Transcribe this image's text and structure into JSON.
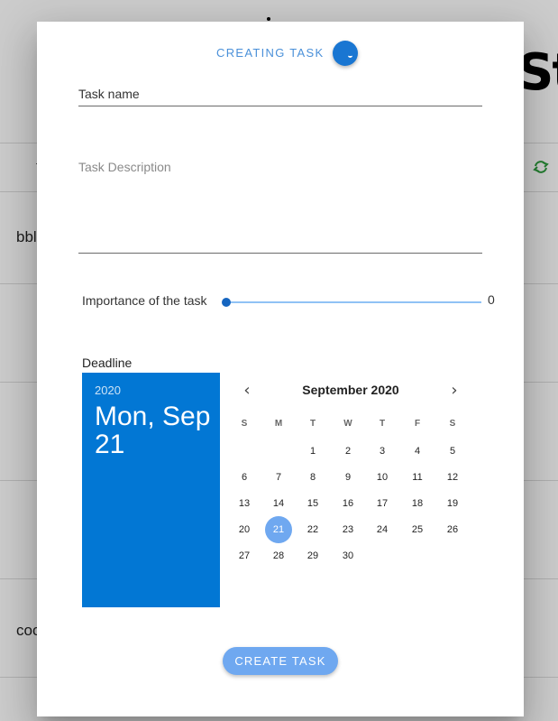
{
  "background": {
    "title_fragment": "St",
    "row1_text": "bbl",
    "row2_text": "coo",
    "right_text": "t"
  },
  "dialog": {
    "title": "CREATING TASK",
    "task_name_label": "Task name",
    "task_description_placeholder": "Task Description",
    "importance_label": "Importance of the task",
    "importance_value": "0",
    "deadline_label": "Deadline",
    "create_button": "CREATE TASK"
  },
  "calendar": {
    "year": "2020",
    "selected_display": "Mon, Sep 21",
    "month_label": "September 2020",
    "weekdays": [
      "S",
      "M",
      "T",
      "W",
      "T",
      "F",
      "S"
    ],
    "first_weekday_index": 2,
    "days": [
      "1",
      "2",
      "3",
      "4",
      "5",
      "6",
      "7",
      "8",
      "9",
      "10",
      "11",
      "12",
      "13",
      "14",
      "15",
      "16",
      "17",
      "18",
      "19",
      "20",
      "21",
      "22",
      "23",
      "24",
      "25",
      "26",
      "27",
      "28",
      "29",
      "30"
    ],
    "selected_day": "21",
    "accent_color": "#0277d4",
    "selected_color": "#6fa8f0"
  },
  "colors": {
    "accent": "#1976d2",
    "button": "#6fa8f0"
  }
}
